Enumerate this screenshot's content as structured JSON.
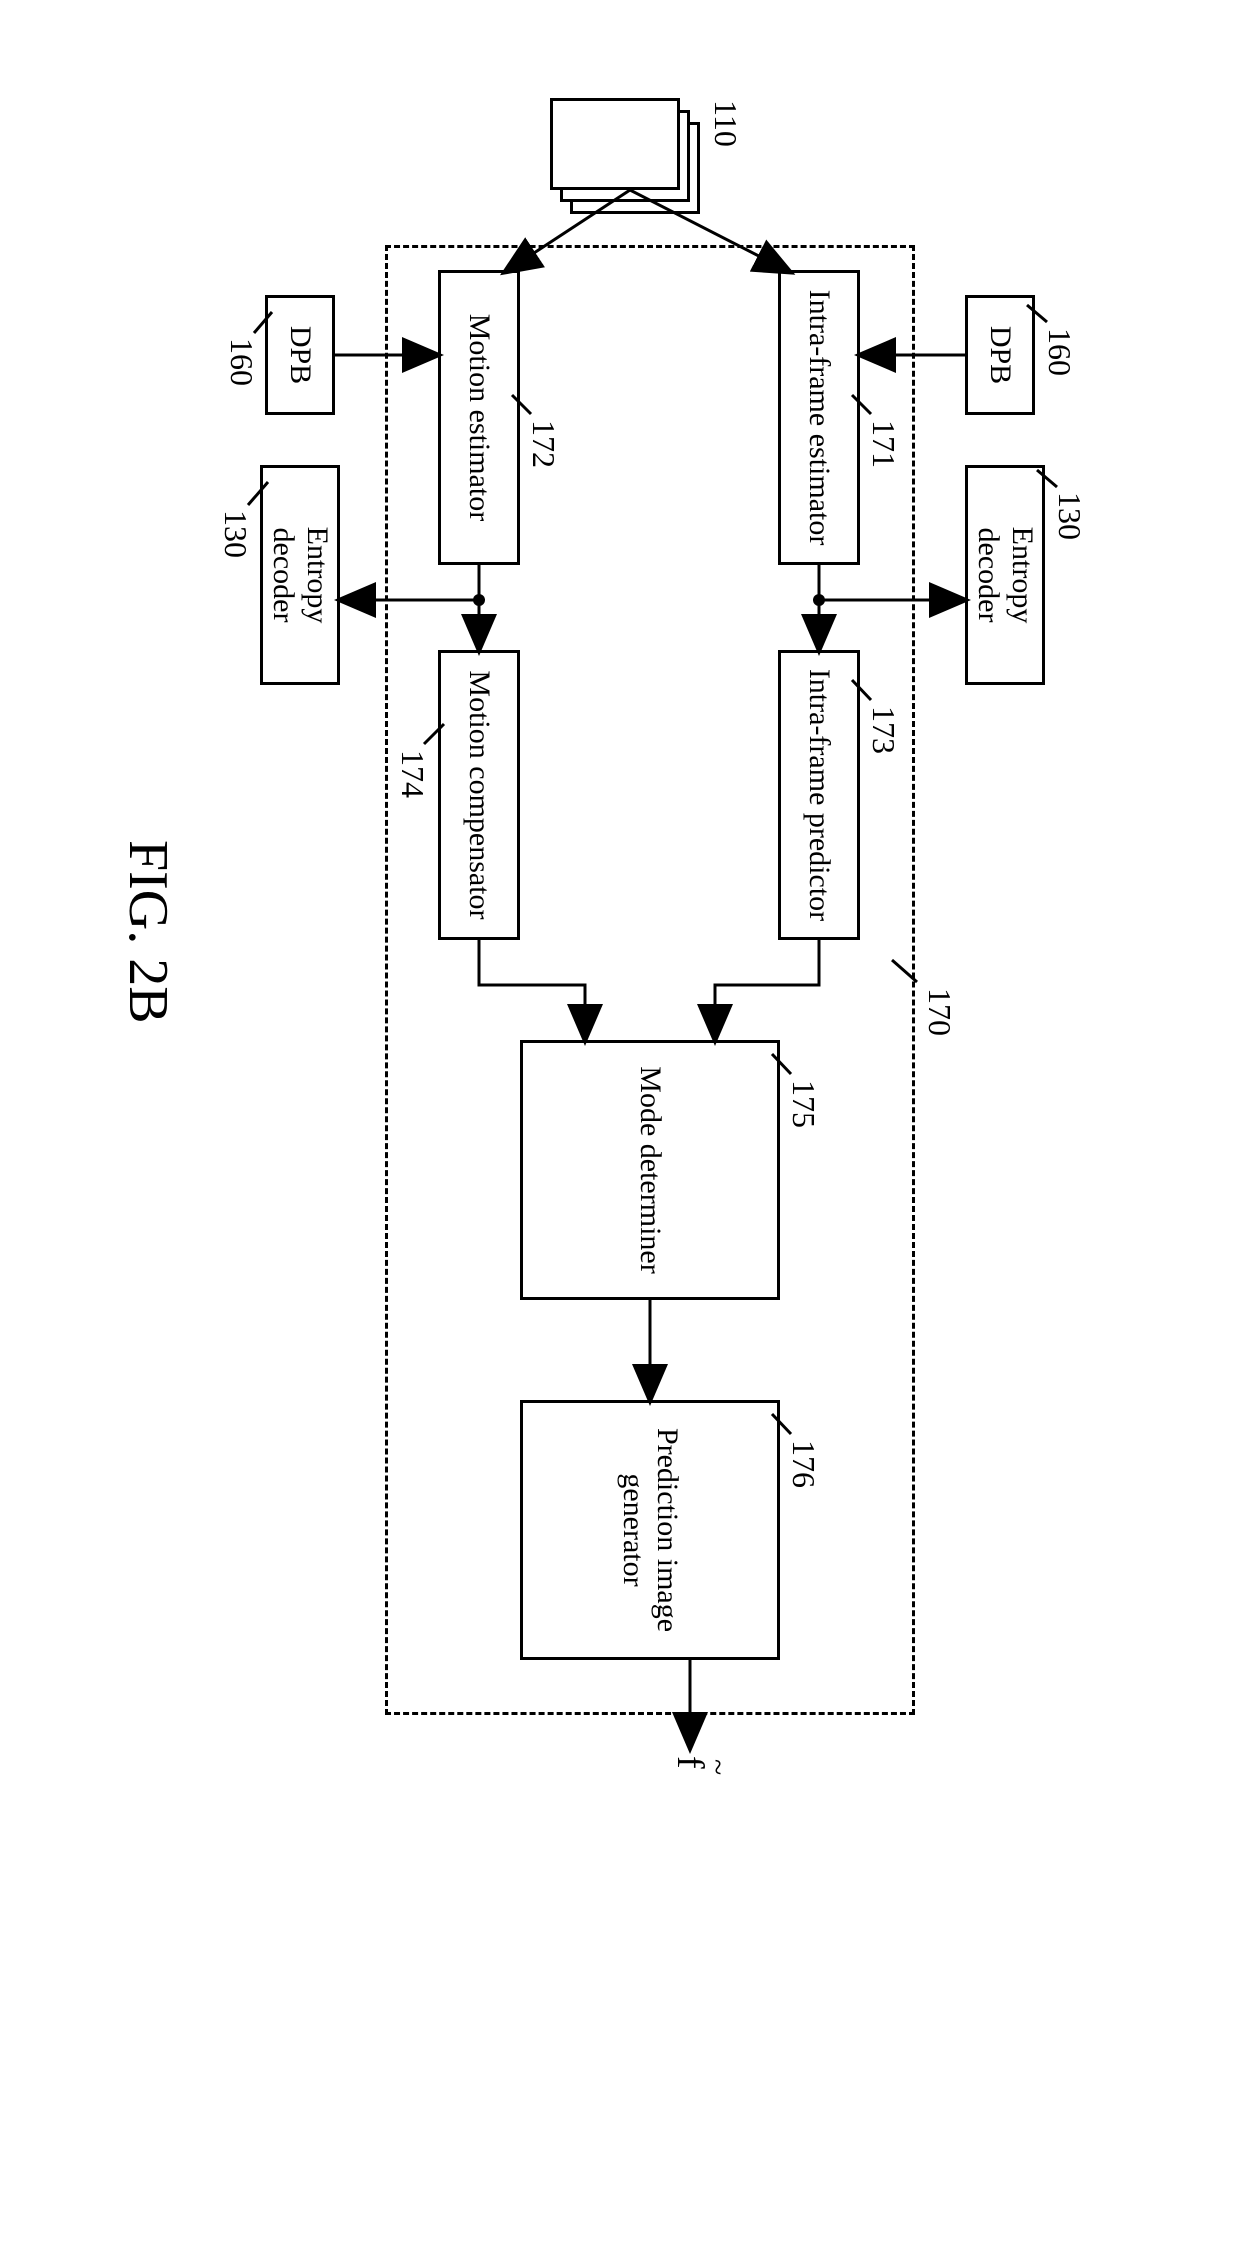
{
  "figure_label": "FIG. 2B",
  "output_symbol": "f",
  "container": {
    "ref": "170"
  },
  "inputs": {
    "frames_stack": {
      "ref": "110"
    }
  },
  "blocks": {
    "dpb_top": {
      "ref": "160",
      "label": "DPB"
    },
    "entropy_top": {
      "ref": "130",
      "label": "Entropy decoder"
    },
    "dpb_bot": {
      "ref": "160",
      "label": "DPB"
    },
    "entropy_bot": {
      "ref": "130",
      "label": "Entropy decoder"
    },
    "intra_est": {
      "ref": "171",
      "label": "Intra-frame estimator"
    },
    "motion_est": {
      "ref": "172",
      "label": "Motion estimator"
    },
    "intra_pred": {
      "ref": "173",
      "label": "Intra-frame predictor"
    },
    "motion_comp": {
      "ref": "174",
      "label": "Motion compensator"
    },
    "mode_det": {
      "ref": "175",
      "label": "Mode determiner"
    },
    "pred_gen": {
      "ref": "176",
      "label": "Prediction image generator"
    }
  }
}
